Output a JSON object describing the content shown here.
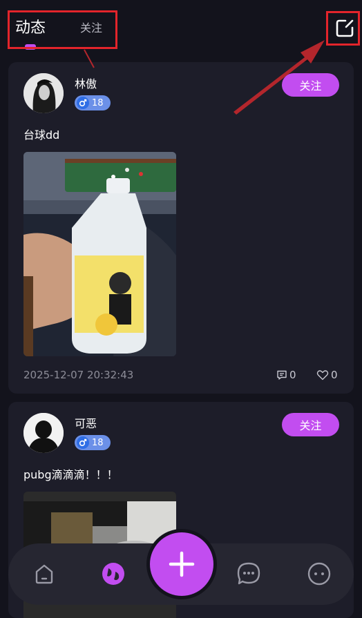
{
  "header": {
    "tabs": [
      {
        "label": "动态",
        "active": true
      },
      {
        "label": "关注",
        "active": false
      }
    ],
    "edit_icon": "edit-icon"
  },
  "posts": [
    {
      "username": "林傲",
      "level": "18",
      "follow_label": "关注",
      "text": "台球dd",
      "timestamp": "2025-12-07 20:32:43",
      "comments": "0",
      "likes": "0"
    },
    {
      "username": "可恶",
      "level": "18",
      "follow_label": "关注",
      "text": "pubg滴滴滴！！！"
    }
  ],
  "nav": {
    "items": [
      {
        "icon": "home-icon"
      },
      {
        "icon": "discover-icon",
        "active": true
      },
      {
        "icon": "add-icon"
      },
      {
        "icon": "messages-icon"
      },
      {
        "icon": "more-icon"
      }
    ]
  },
  "colors": {
    "accent": "#c24df0",
    "background": "#13131c",
    "card": "#1d1d29",
    "annotation": "#e3242b"
  }
}
